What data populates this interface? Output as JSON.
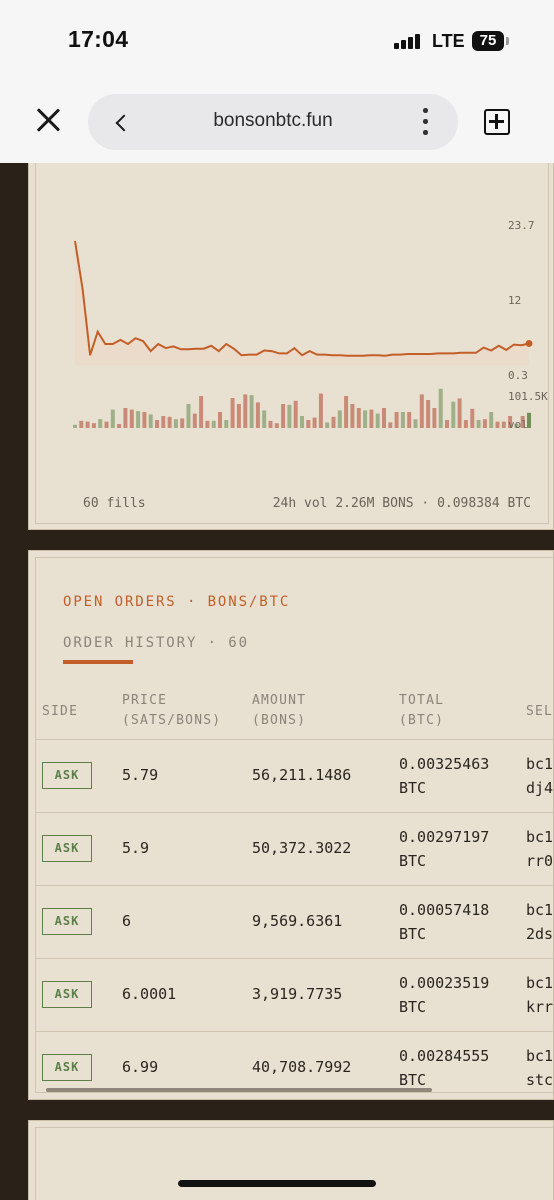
{
  "status_bar": {
    "time": "17:04",
    "network": "LTE",
    "battery": "75"
  },
  "browser": {
    "url": "bonsonbtc.fun"
  },
  "chart": {
    "y_ticks": [
      "23.7",
      "12",
      "0.3"
    ],
    "vol_max_label": "101.5K",
    "vol_label": "vol",
    "fills_label": "60 fills",
    "volume_summary": "24h vol 2.26M BONS · 0.098384 BTC"
  },
  "chart_data": {
    "type": "line",
    "series": [
      {
        "values": [
          23.7,
          15.5,
          4.2,
          8.2,
          6.1,
          6.1,
          6.8,
          6.1,
          7.1,
          6.6,
          4.9,
          6.1,
          5.4,
          5.7,
          5.2,
          5.2,
          5.3,
          5.3,
          5.8,
          4.9,
          6.1,
          5.3,
          4.2,
          4.3,
          4.3,
          5.0,
          4.9,
          4.5,
          4.5,
          5.4,
          4.2,
          4.9,
          4.3,
          4.3,
          4.2,
          4.2,
          4.1,
          4.1,
          4.1,
          4.2,
          4.2,
          4.1,
          4.3,
          4.3,
          4.4,
          4.4,
          4.4,
          4.4,
          4.5,
          4.5,
          4.5,
          4.6,
          4.6,
          4.6,
          5.5,
          5.0,
          5.8,
          5.1,
          6.0,
          5.9,
          6.2
        ]
      },
      {
        "name": "vol",
        "values": [
          8,
          18,
          16,
          12,
          22,
          16,
          46,
          10,
          50,
          46,
          42,
          40,
          34,
          20,
          30,
          28,
          22,
          24,
          60,
          36,
          80,
          18,
          18,
          40,
          20,
          75,
          60,
          84,
          82,
          64,
          44,
          18,
          12,
          60,
          58,
          68,
          30,
          20,
          26,
          86,
          14,
          28,
          44,
          80,
          60,
          50,
          44,
          46,
          36,
          50,
          14,
          40,
          40,
          40,
          22,
          84,
          70,
          50,
          98,
          20,
          66,
          74,
          20,
          48,
          20,
          22,
          40,
          16,
          16,
          30,
          10,
          30,
          38
        ]
      }
    ],
    "ylim": [
      0.3,
      23.7
    ],
    "vol_max": "101.5K"
  },
  "orders": {
    "tab_open": "OPEN ORDERS · BONS/BTC",
    "tab_history": "ORDER HISTORY · 60",
    "columns": {
      "side": "SIDE",
      "price_1": "PRICE",
      "price_2": "(SATS/BONS)",
      "amount_1": "AMOUNT",
      "amount_2": "(BONS)",
      "total_1": "TOTAL",
      "total_2": "(BTC)",
      "seller": "SEL"
    },
    "rows": [
      {
        "side": "ASK",
        "price": "5.79",
        "amount": "56,211.1486",
        "total": "0.00325463",
        "unit": "BTC",
        "addr1": "bc1",
        "addr2": "dj4"
      },
      {
        "side": "ASK",
        "price": "5.9",
        "amount": "50,372.3022",
        "total": "0.00297197",
        "unit": "BTC",
        "addr1": "bc1",
        "addr2": "rr0"
      },
      {
        "side": "ASK",
        "price": "6",
        "amount": "9,569.6361",
        "total": "0.00057418",
        "unit": "BTC",
        "addr1": "bc1",
        "addr2": "2ds"
      },
      {
        "side": "ASK",
        "price": "6.0001",
        "amount": "3,919.7735",
        "total": "0.00023519",
        "unit": "BTC",
        "addr1": "bc1",
        "addr2": "krr"
      },
      {
        "side": "ASK",
        "price": "6.99",
        "amount": "40,708.7992",
        "total": "0.00284555",
        "unit": "BTC",
        "addr1": "bc1",
        "addr2": "stc"
      }
    ]
  },
  "colors": {
    "accent": "#c45e28",
    "ask_green": "#5d7f4a",
    "panel_bg": "#e8e1d1",
    "page_bg": "#2a2118"
  }
}
